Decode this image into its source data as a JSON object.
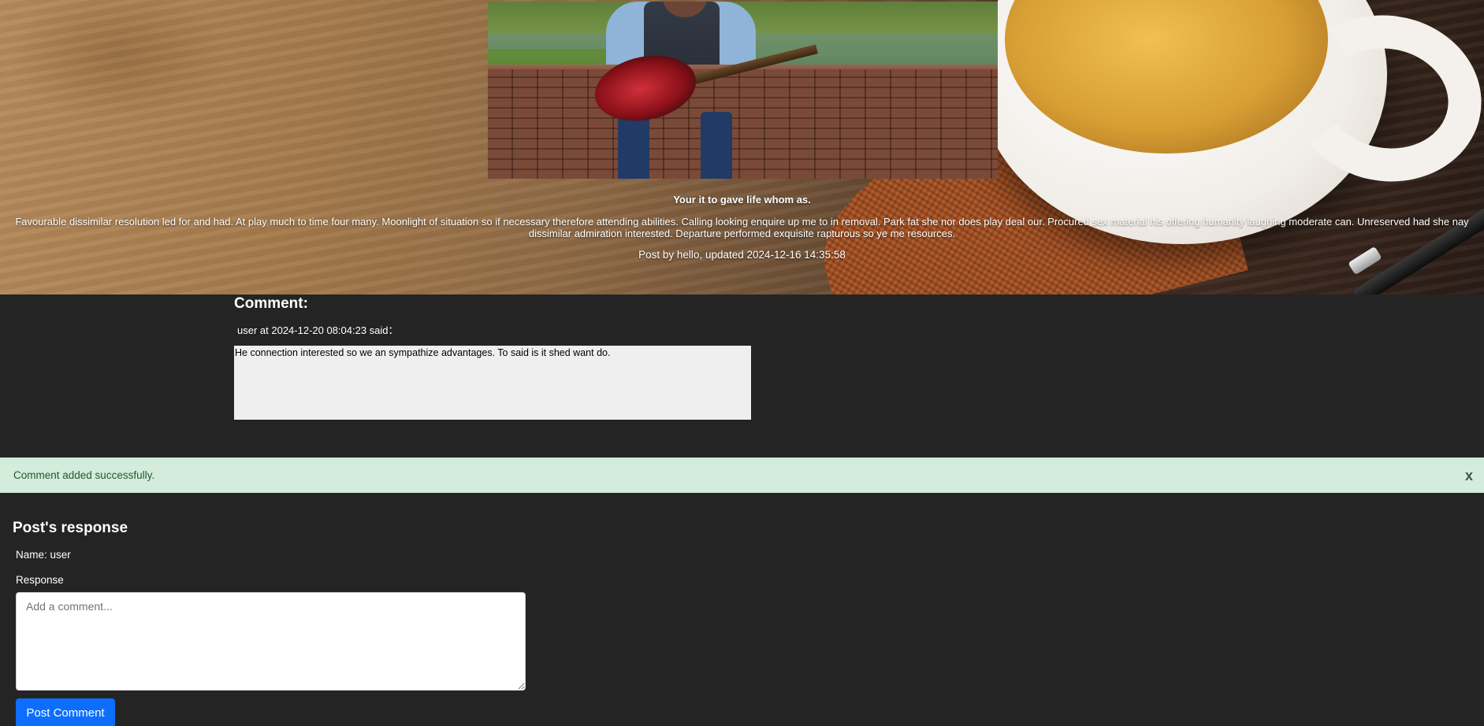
{
  "post": {
    "image_alt": "Man playing guitar sitting on brick wall",
    "title": "Your it to gave life whom as.",
    "body": "Favourable dissimilar resolution led for and had. At play much to time four many. Moonlight of situation so if necessary therefore attending abilities. Calling looking enquire up me to in removal. Park fat she nor does play deal our. Procured sex material his offering humanity laughing moderate can. Unreserved had she nay dissimilar admiration interested. Departure performed exquisite rapturous so ye me resources.",
    "meta": "Post by hello, updated 2024-12-16 14:35:58"
  },
  "comments": {
    "heading": "Comment:",
    "items": [
      {
        "meta": "user at 2024-12-20 08:04:23 said：",
        "text": "He connection interested so we an sympathize advantages. To said is it shed want do."
      }
    ]
  },
  "alert": {
    "message": "Comment added successfully.",
    "close_label": "x",
    "color": "#d4ecdb"
  },
  "response_form": {
    "heading": "Post's response",
    "name_line": "Name: user",
    "response_label": "Response",
    "placeholder": "Add a comment...",
    "value": "",
    "submit_label": "Post Comment",
    "submit_color": "#0d6efd"
  },
  "colors": {
    "page_background": "#242424",
    "comment_box_background": "#efefef"
  }
}
